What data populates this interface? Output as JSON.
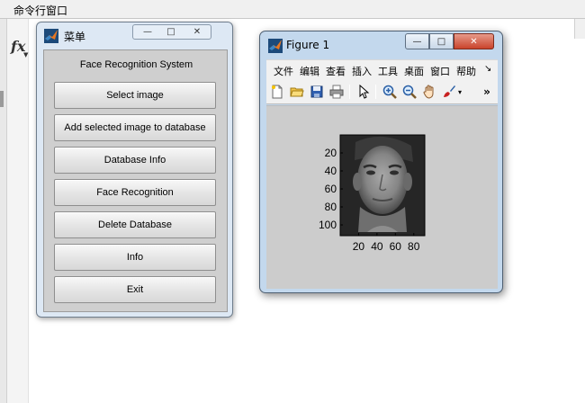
{
  "command_window": {
    "title": "命令行窗口",
    "fx_symbol": "fx"
  },
  "menu_window": {
    "title": "菜单",
    "app_title": "Face Recognition System",
    "buttons": [
      "Select image",
      "Add selected image to database",
      "Database Info",
      "Face Recognition",
      "Delete Database",
      "Info",
      "Exit"
    ],
    "controls": {
      "minimize": "—",
      "maximize": "□",
      "close": "✕"
    }
  },
  "figure_window": {
    "title": "Figure 1",
    "menu_items": [
      "文件",
      "编辑",
      "查看",
      "插入",
      "工具",
      "桌面",
      "窗口",
      "帮助"
    ],
    "menu_more": "↘",
    "toolbar_icons": [
      "new-file-icon",
      "open-folder-icon",
      "save-icon",
      "print-icon",
      "pointer-icon",
      "zoom-in-icon",
      "zoom-out-icon",
      "pan-hand-icon",
      "brush-icon"
    ],
    "toolbar_more": "»",
    "controls": {
      "minimize": "—",
      "maximize": "□",
      "close": "✕"
    },
    "plot": {
      "y_ticks": [
        "20",
        "40",
        "60",
        "80",
        "100"
      ],
      "x_ticks": [
        "20",
        "40",
        "60",
        "80"
      ]
    }
  }
}
